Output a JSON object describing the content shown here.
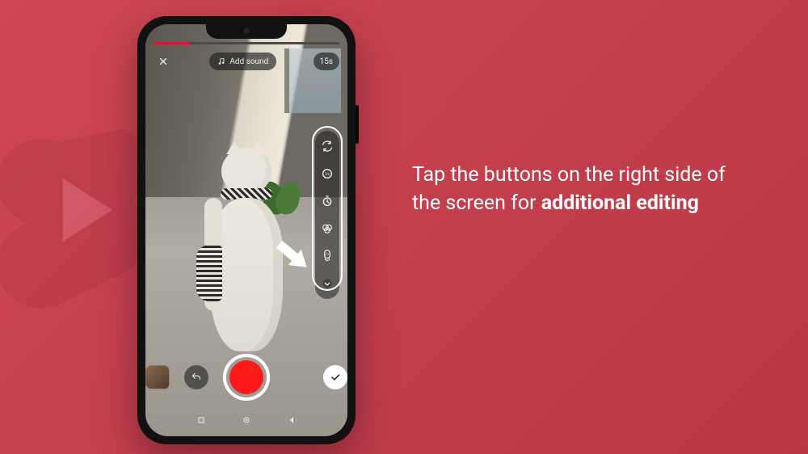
{
  "instruction": {
    "part1": "Tap the buttons on the right side of the screen for ",
    "bold": "additional editing"
  },
  "topbar": {
    "close_label": "Close",
    "add_sound_label": "Add sound",
    "duration_label": "15s"
  },
  "side_tools": {
    "flip": "flip-camera-icon",
    "speed": "speed-icon",
    "timer": "timer-icon",
    "filters": "filters-icon",
    "effects": "effects-icon",
    "more": "expand-icon"
  },
  "controls": {
    "gallery_label": "Gallery",
    "undo_label": "Undo",
    "record_label": "Record",
    "confirm_label": "Confirm"
  },
  "nav": {
    "recent": "recent-apps",
    "home": "home",
    "back": "back"
  }
}
